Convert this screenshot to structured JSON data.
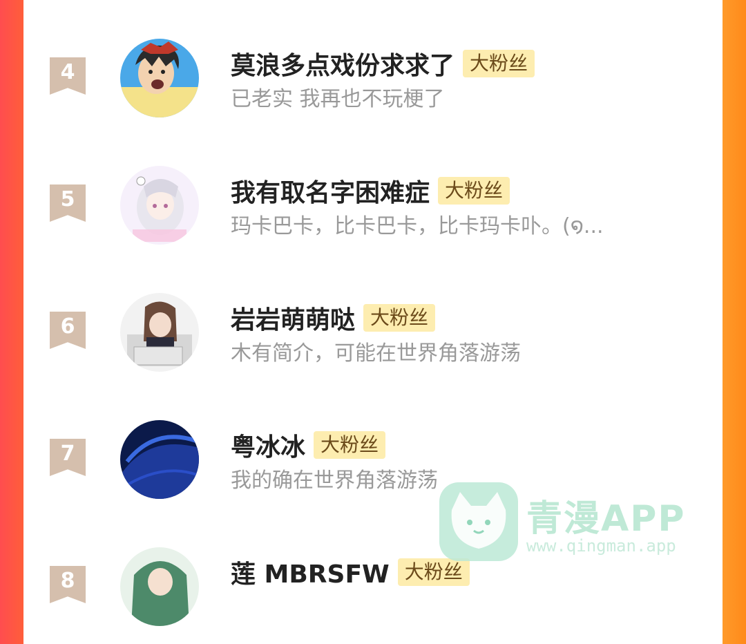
{
  "colors": {
    "left_edge": "#ff4d4f",
    "right_edge": "#ff8a1a",
    "rank_ribbon": "#d5bfad",
    "badge_bg": "#fdedb0",
    "name_text": "#222222",
    "bio_text": "#999999",
    "watermark": "#bfe9d6"
  },
  "badge_label": "大粉丝",
  "fans": [
    {
      "rank": "4",
      "name": "莫浪多点戏份求求了",
      "bio": "已老实 我再也不玩梗了",
      "avatar_icon": "cartoon-boy-avatar"
    },
    {
      "rank": "5",
      "name": "我有取名字困难症",
      "bio": "玛卡巴卡，比卡巴卡，比卡玛卡卟。(໑...",
      "avatar_icon": "anime-girl-avatar"
    },
    {
      "rank": "6",
      "name": "岩岩萌萌哒",
      "bio": "木有简介，可能在世界角落游荡",
      "avatar_icon": "doll-photo-avatar"
    },
    {
      "rank": "7",
      "name": "粤冰冰",
      "bio": "我的确在世界角落游荡",
      "avatar_icon": "blue-abstract-avatar"
    },
    {
      "rank": "8",
      "name": "莲 MBRSFW",
      "bio": "",
      "avatar_icon": "green-hair-avatar"
    }
  ],
  "watermark": {
    "title": "青漫APP",
    "url": "www.qingman.app",
    "icon": "cat-logo-icon"
  }
}
